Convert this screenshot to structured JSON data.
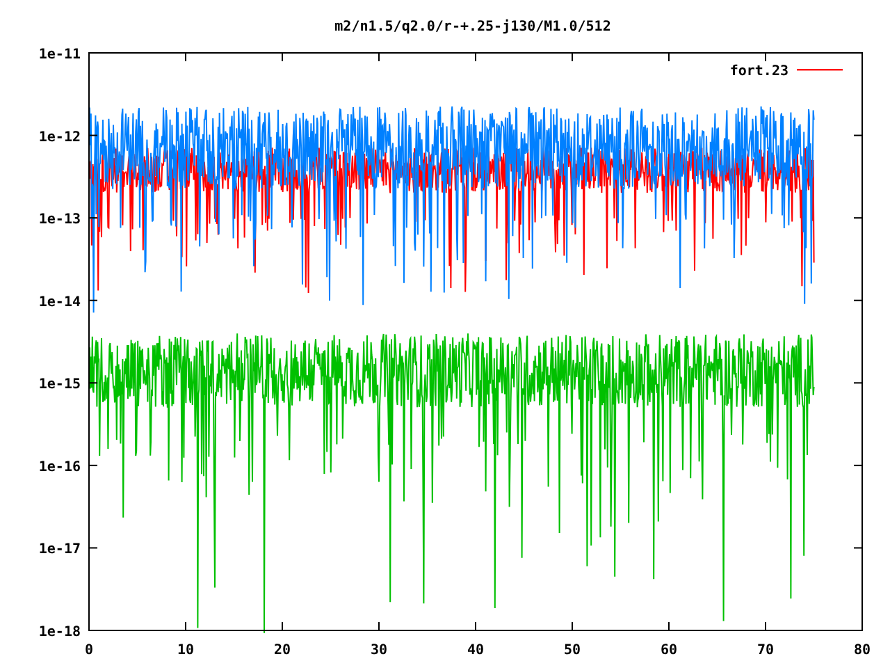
{
  "plot": {
    "title": "m2/n1.5/q2.0/r-+.25-j130/M1.0/512",
    "y_axis_labels": [
      "1e-11",
      "1e-12",
      "1e-13",
      "1e-14",
      "1e-15",
      "1e-16",
      "1e-17",
      "1e-18"
    ],
    "x_axis_labels": [
      "0",
      "10",
      "20",
      "30",
      "40",
      "50",
      "60",
      "70",
      "80"
    ],
    "legend": [
      {
        "label": "fort.23",
        "color": "#ff0000"
      }
    ]
  }
}
